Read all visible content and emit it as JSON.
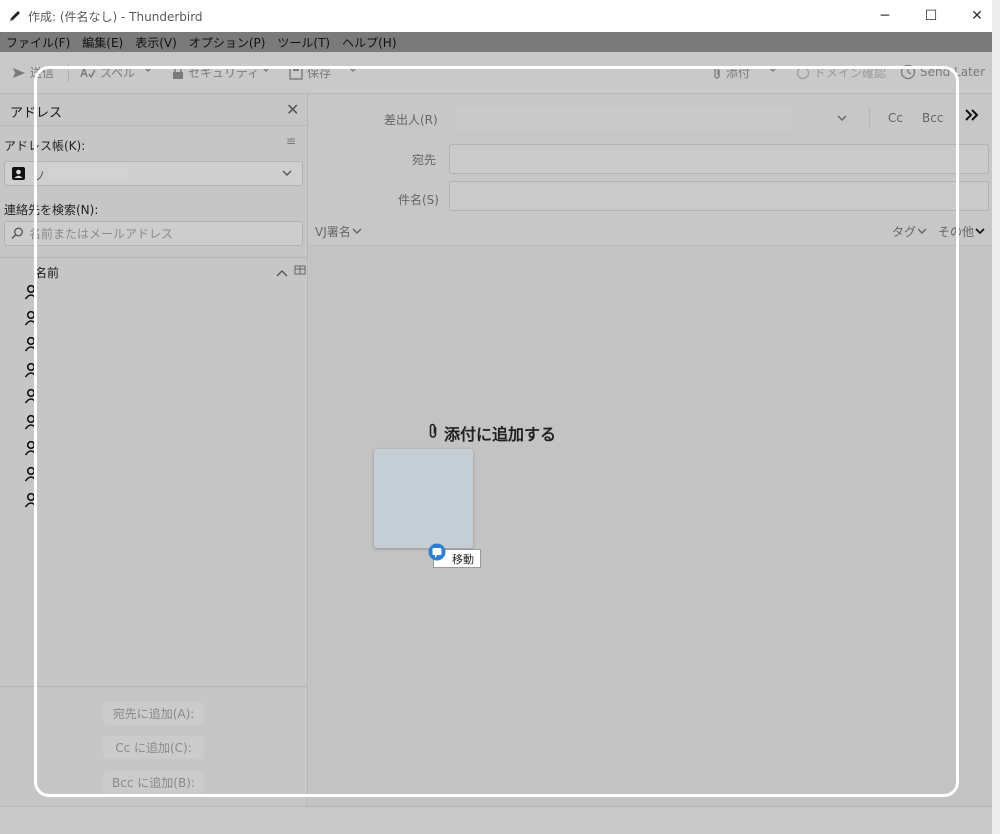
{
  "window": {
    "title": "作成: (件名なし) - Thunderbird",
    "minimize_glyph": "─",
    "maximize_glyph": "☐",
    "close_glyph": "✕"
  },
  "menu": [
    "ファイル(F)",
    "編集(E)",
    "表示(V)",
    "オプション(P)",
    "ツール(T)",
    "ヘルプ(H)"
  ],
  "toolbar": {
    "send": "送信",
    "spell": "スペル",
    "security": "セキュリティ",
    "save": "保存",
    "attach": "添付",
    "domain_check": "ドメイン確認",
    "send_later": "Send Later"
  },
  "sidebar": {
    "title": "アドレス",
    "addressbook_label": "アドレス帳(K):",
    "addressbook_value": "ソ",
    "search_label": "連絡先を検索(N):",
    "search_placeholder": "名前またはメールアドレス",
    "name_column": "名前",
    "contact_count": 9,
    "buttons": [
      "宛先に追加(A):",
      "Cc に追加(C):",
      "Bcc に追加(B):"
    ]
  },
  "header": {
    "from_label": "差出人(R)",
    "to_label": "宛先",
    "subject_label": "件名(S)",
    "cc": "Cc",
    "bcc": "Bcc",
    "signature": "VJ署名",
    "tag": "タグ",
    "other": "その他"
  },
  "dragdrop": {
    "drop_label": "添付に追加する",
    "move_tooltip": "移動"
  },
  "colors": {
    "overlay_border": "#ffffff",
    "drag_badge": "#2a7fd4"
  }
}
